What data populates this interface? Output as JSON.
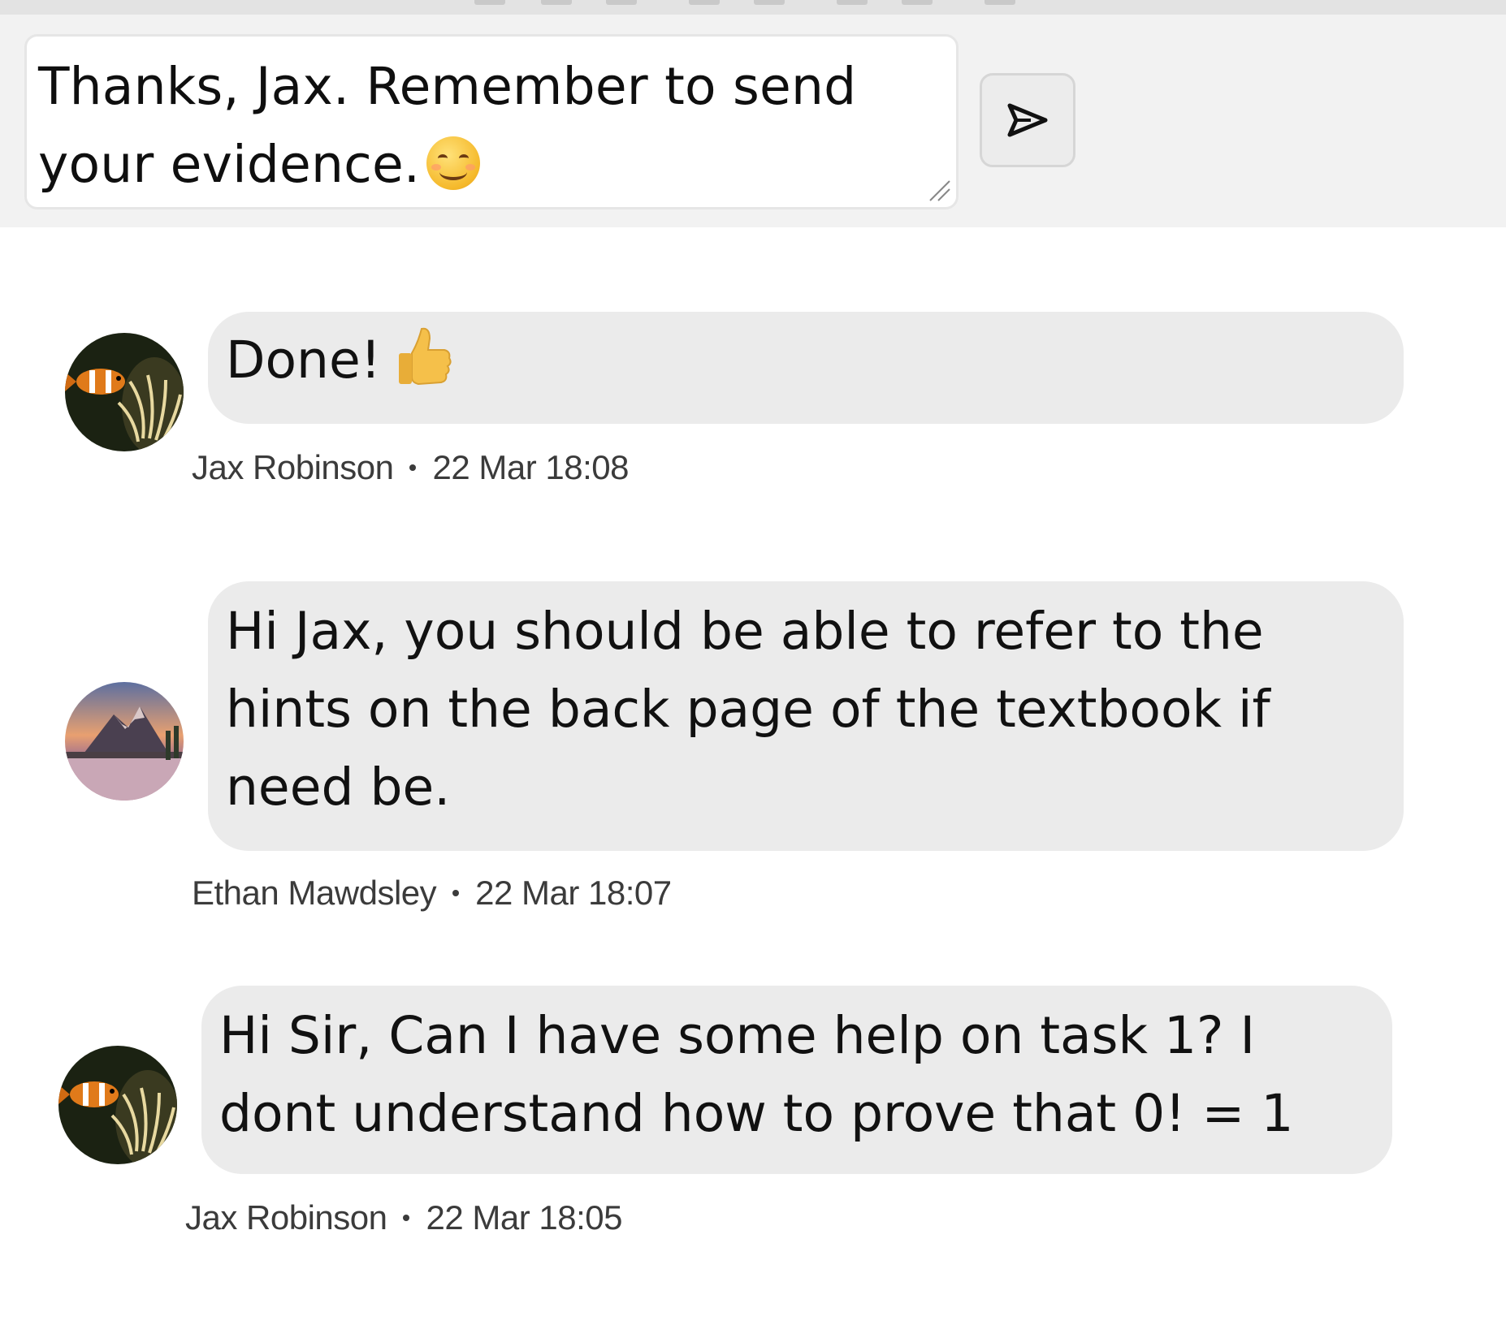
{
  "composer": {
    "draft_text": "Thanks, Jax. Remember to send your evidence.",
    "draft_emoji": "smiling-face",
    "send_icon": "send-icon"
  },
  "messages": [
    {
      "text": "Done!",
      "emoji": "thumbs-up",
      "author": "Jax Robinson",
      "timestamp": "22 Mar 18:08",
      "avatar": "clownfish-avatar"
    },
    {
      "text": "Hi Jax, you should be able to refer to the hints on the back page of the textbook if need be.",
      "author": "Ethan Mawdsley",
      "timestamp": "22 Mar 18:07",
      "avatar": "mountain-sunset-avatar"
    },
    {
      "text": "Hi Sir, Can I have some help on task 1? I dont understand how to prove that 0! = 1",
      "author": "Jax Robinson",
      "timestamp": "22 Mar 18:05",
      "avatar": "clownfish-avatar"
    }
  ],
  "colors": {
    "composer_bg": "#f2f2f2",
    "bubble_bg": "#ebebeb",
    "meta_text": "#3b3b3b"
  }
}
